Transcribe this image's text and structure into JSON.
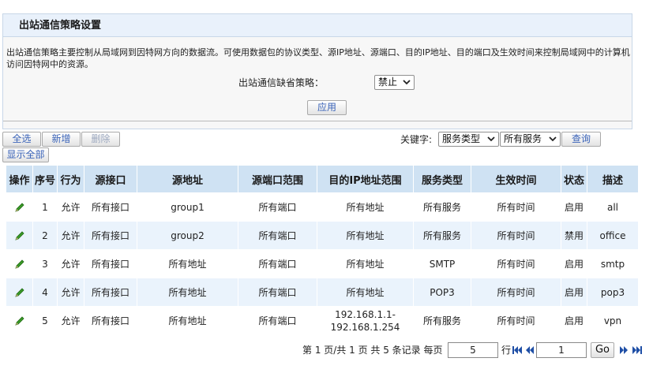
{
  "panel": {
    "title": "出站通信策略设置",
    "description": "出站通信策略主要控制从局域网到因特网方向的数据流。可使用数据包的协议类型、源IP地址、源端口、目的IP地址、目的端口及生效时间来控制局域网中的计算机访问因特网中的资源。",
    "default_policy_label": "出站通信缺省策略：",
    "default_policy_value": "禁止",
    "apply_label": "应用"
  },
  "toolbar": {
    "select_all_label": "全选",
    "add_label": "新增",
    "delete_label": "删除",
    "show_all_label": "显示全部",
    "keyword_label": "关键字:",
    "filter_type": "服务类型",
    "filter_value": "所有服务",
    "search_label": "查询"
  },
  "table": {
    "columns": [
      "操作",
      "序号",
      "行为",
      "源接口",
      "源地址",
      "源端口范围",
      "目的IP地址范围",
      "服务类型",
      "生效时间",
      "状态",
      "描述"
    ],
    "rows": [
      {
        "index": "1",
        "action": "允许",
        "src_if": "所有接口",
        "src_addr": "group1",
        "src_port": "所有端口",
        "dst_ip": "所有地址",
        "service": "所有服务",
        "time": "所有时间",
        "status": "启用",
        "desc": "all"
      },
      {
        "index": "2",
        "action": "允许",
        "src_if": "所有接口",
        "src_addr": "group2",
        "src_port": "所有端口",
        "dst_ip": "所有地址",
        "service": "所有服务",
        "time": "所有时间",
        "status": "禁用",
        "desc": "office"
      },
      {
        "index": "3",
        "action": "允许",
        "src_if": "所有接口",
        "src_addr": "所有地址",
        "src_port": "所有端口",
        "dst_ip": "所有地址",
        "service": "SMTP",
        "time": "所有时间",
        "status": "启用",
        "desc": "smtp"
      },
      {
        "index": "4",
        "action": "允许",
        "src_if": "所有接口",
        "src_addr": "所有地址",
        "src_port": "所有端口",
        "dst_ip": "所有地址",
        "service": "POP3",
        "time": "所有时间",
        "status": "启用",
        "desc": "pop3"
      },
      {
        "index": "5",
        "action": "允许",
        "src_if": "所有接口",
        "src_addr": "所有地址",
        "src_port": "所有端口",
        "dst_ip": "192.168.1.1-\n192.168.1.254",
        "service": "所有服务",
        "time": "所有时间",
        "status": "启用",
        "desc": "vpn"
      }
    ]
  },
  "pager": {
    "summary": "第 1 页/共 1 页 共 5 条记录 每页",
    "per_page": "5",
    "row_unit": "行",
    "page_input": "1",
    "go_label": "Go"
  },
  "colors": {
    "header_bg": "#cfe2f3",
    "alt_row_bg": "#eaf3fc",
    "link_blue": "#3a63b8",
    "edit_green": "#2f8a1e"
  }
}
